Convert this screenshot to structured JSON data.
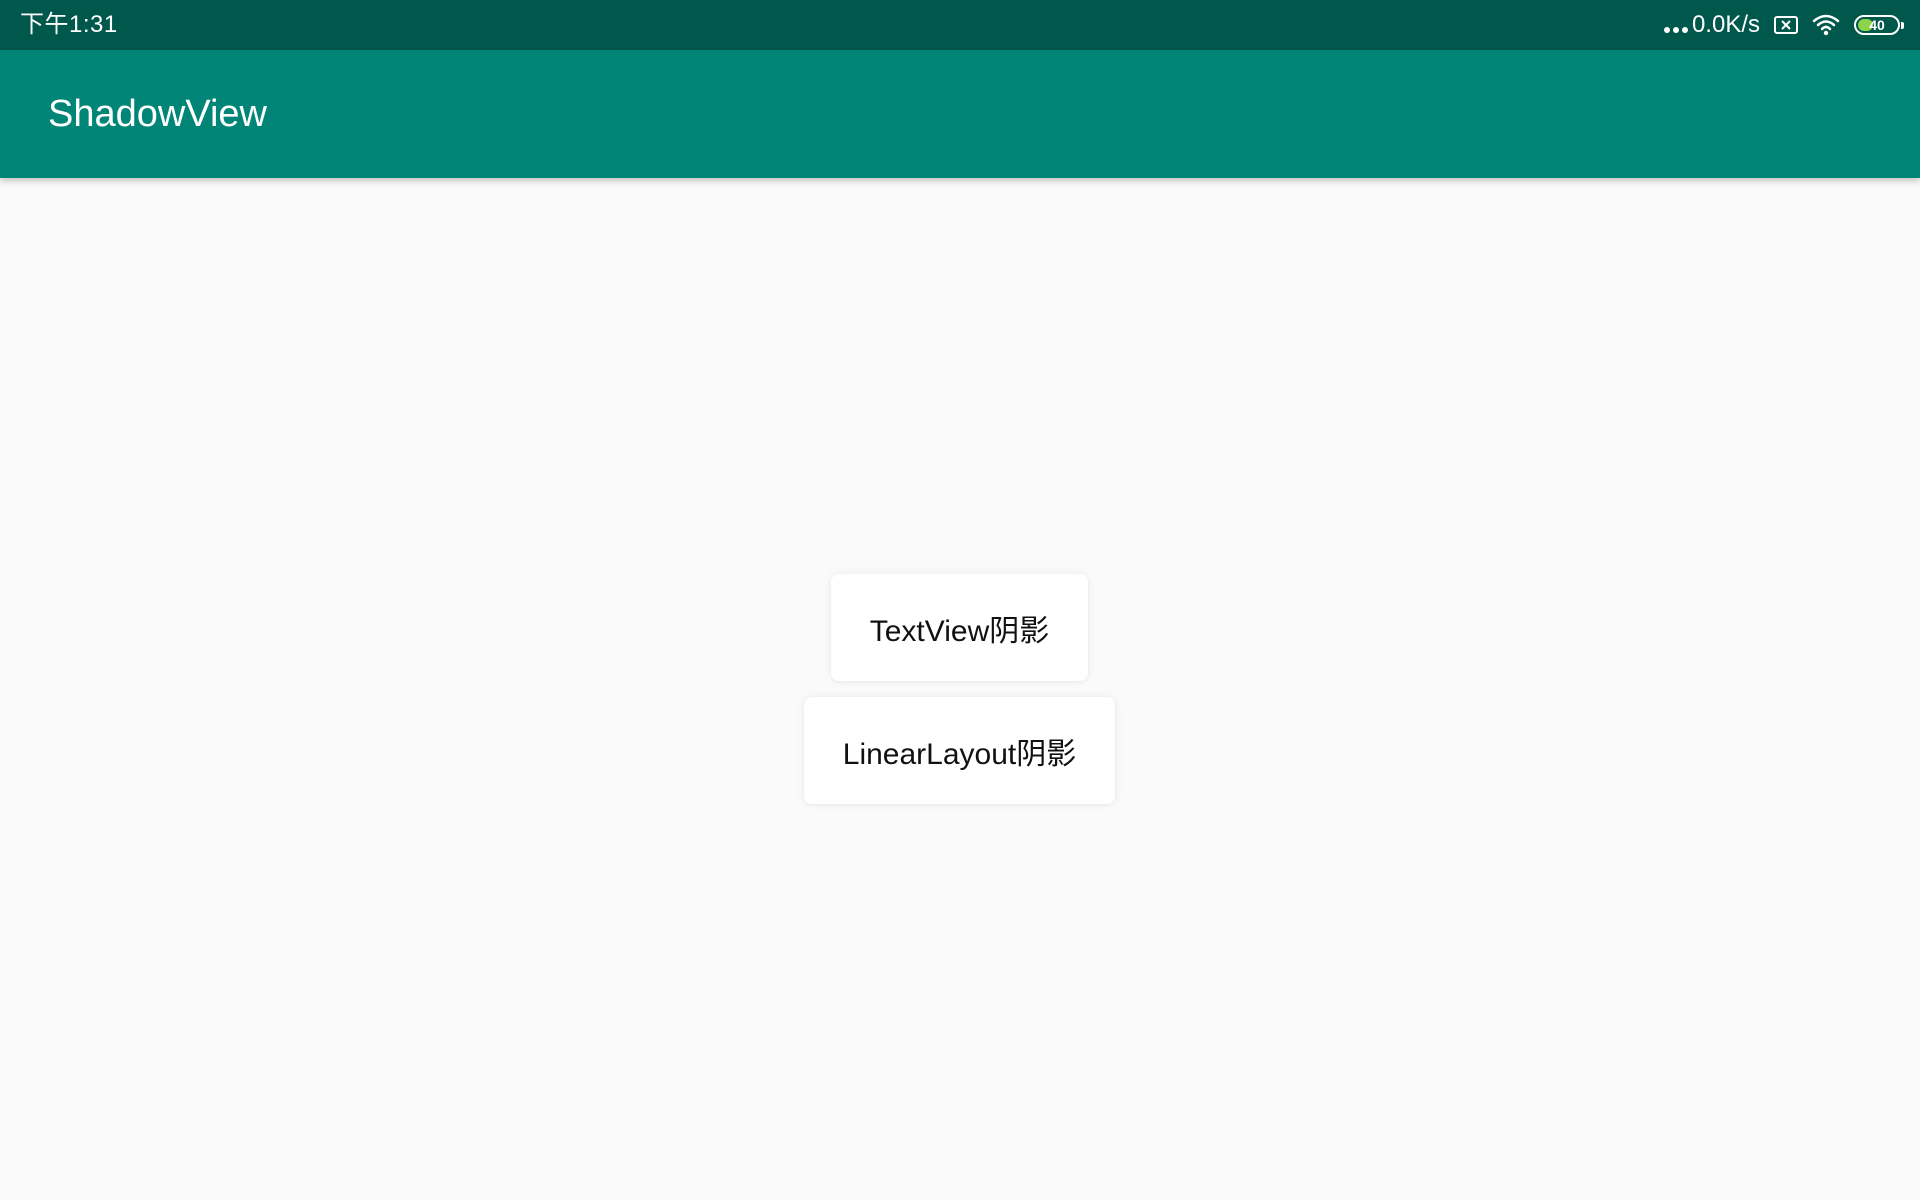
{
  "status_bar": {
    "time": "下午1:31",
    "net_speed": "0.0K/s",
    "battery_level": 40,
    "battery_label": "40",
    "icons": [
      "signal-dots-icon",
      "no-sim-icon",
      "wifi-icon",
      "battery-icon"
    ],
    "colors": {
      "background": "#00574b",
      "battery_fill": "#8bd34b"
    }
  },
  "app_bar": {
    "title": "ShadowView",
    "colors": {
      "background": "#008577",
      "text": "#ffffff"
    }
  },
  "main": {
    "textview_card": {
      "label": "TextView阴影"
    },
    "linearlayout_card": {
      "label": "LinearLayout阴影"
    },
    "colors": {
      "background": "#fafafa",
      "card": "#ffffff"
    }
  }
}
